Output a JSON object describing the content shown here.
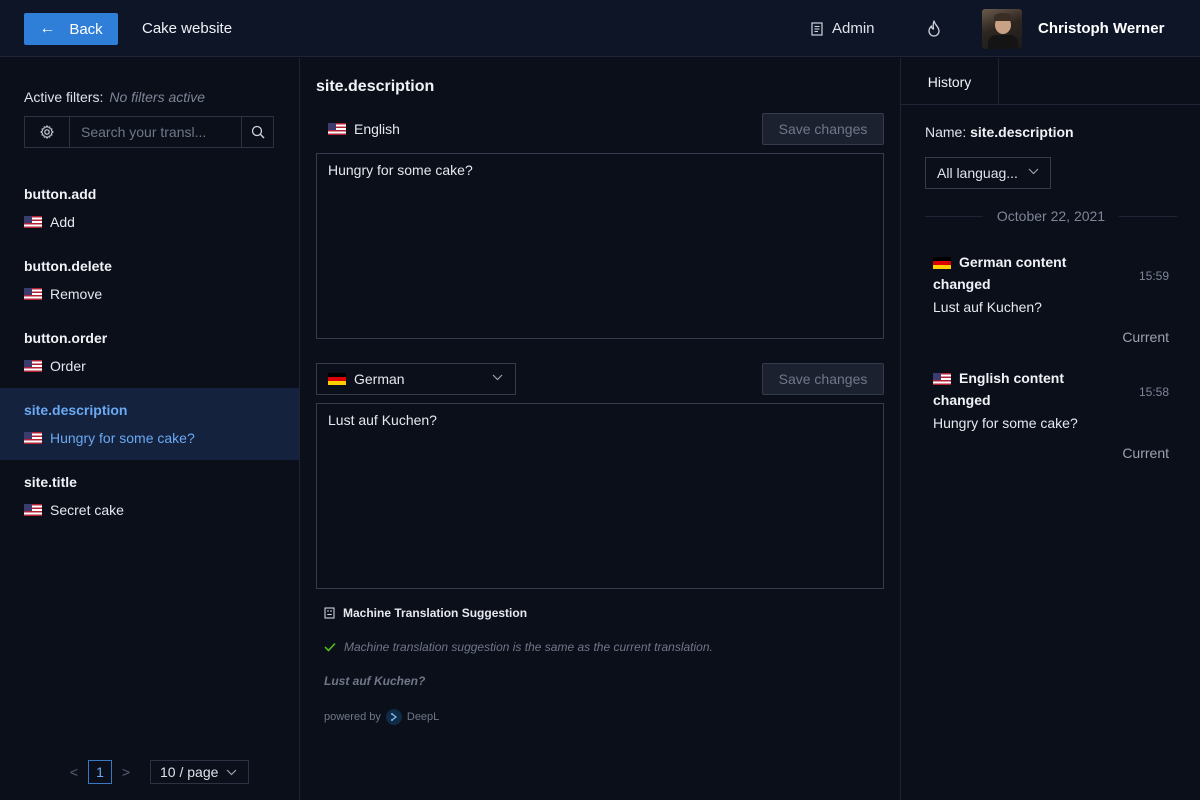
{
  "header": {
    "back_label": "Back",
    "project_name": "Cake website",
    "admin_label": "Admin",
    "user_name": "Christoph Werner"
  },
  "filters": {
    "label": "Active filters:",
    "value": "No filters active",
    "search_placeholder": "Search your transl..."
  },
  "keys": [
    {
      "key": "button.add",
      "value": "Add",
      "flag": "us-flag-icon"
    },
    {
      "key": "button.delete",
      "value": "Remove",
      "flag": "us-flag-icon"
    },
    {
      "key": "button.order",
      "value": "Order",
      "flag": "us-flag-icon"
    },
    {
      "key": "site.description",
      "value": "Hungry for some cake?",
      "flag": "us-flag-icon",
      "active": true
    },
    {
      "key": "site.title",
      "value": "Secret cake",
      "flag": "us-flag-icon"
    }
  ],
  "pagination": {
    "prev": "<",
    "current_page": "1",
    "next": ">",
    "page_size": "10 / page"
  },
  "editor": {
    "key_title": "site.description",
    "source": {
      "language": "English",
      "text": "Hungry for some cake?",
      "save_label": "Save changes"
    },
    "target": {
      "language": "German",
      "text": "Lust auf Kuchen?",
      "save_label": "Save changes"
    },
    "machine_translation": {
      "heading": "Machine Translation Suggestion",
      "status": "Machine translation suggestion is the same as the current translation.",
      "suggestion": "Lust auf Kuchen?",
      "powered_by": "powered by",
      "provider": "DeepL"
    }
  },
  "history": {
    "tab_label": "History",
    "name_label": "Name:",
    "name_value": "site.description",
    "language_filter": "All languag...",
    "date": "October 22, 2021",
    "entries": [
      {
        "title": "German content changed",
        "flag": "de-flag-icon",
        "time": "15:59",
        "text": "Lust auf Kuchen?",
        "status": "Current"
      },
      {
        "title": "English content changed",
        "flag": "us-flag-icon",
        "time": "15:58",
        "text": "Hungry for some cake?",
        "status": "Current"
      }
    ]
  },
  "colors": {
    "background": "#0b0f1a",
    "header_bg": "#0e1527",
    "accent": "#2f7fd9",
    "active_row_bg": "#14223d",
    "active_text": "#6aa9f3",
    "muted_text": "#6f7789",
    "success": "#52c41a"
  }
}
